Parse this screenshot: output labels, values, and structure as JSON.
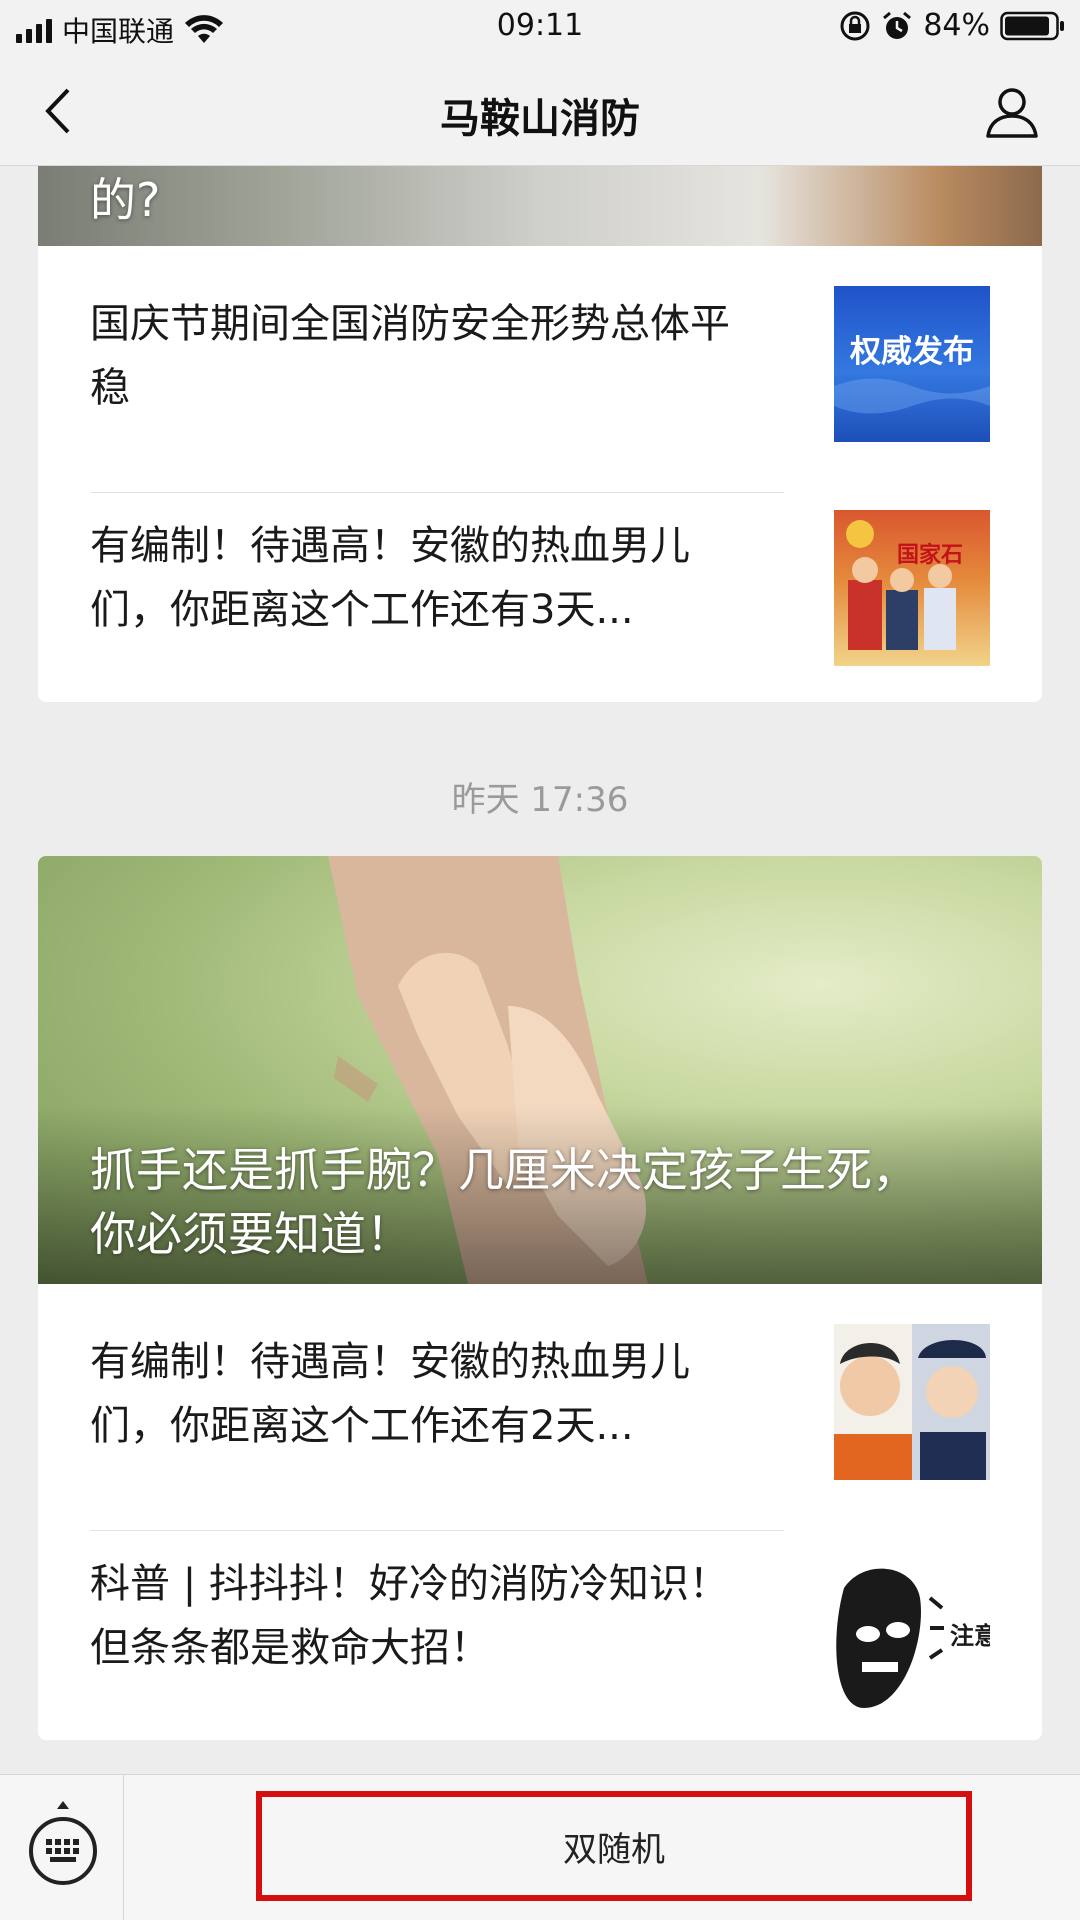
{
  "status_bar": {
    "carrier": "中国联通",
    "time": "09:11",
    "battery": "84%"
  },
  "nav": {
    "title": "马鞍山消防"
  },
  "group1": {
    "hero_title": "的?",
    "items": [
      {
        "title": "国庆节期间全国消防安全形势总体平稳",
        "thumb_text": "权威发布"
      },
      {
        "title": "有编制！待遇高！安徽的热血男儿们，你距离这个工作还有3天...",
        "thumb_text": "国家石"
      }
    ]
  },
  "timestamp": "昨天 17:36",
  "group2": {
    "hero_title": "抓手还是抓手腕？几厘米决定孩子生死，你必须要知道！",
    "items": [
      {
        "title": "有编制！待遇高！安徽的热血男儿们，你距离这个工作还有2天..."
      },
      {
        "title": "科普 | 抖抖抖！好冷的消防冷知识！但条条都是救命大招！",
        "thumb_text": "注意"
      }
    ]
  },
  "bottom_bar": {
    "menu_label": "双随机"
  },
  "colors": {
    "highlight_border": "#d30f0f",
    "background": "#ededed"
  },
  "icons": [
    "signal-icon",
    "wifi-icon",
    "rotation-lock-icon",
    "alarm-icon",
    "battery-icon",
    "back-icon",
    "profile-icon",
    "keyboard-icon"
  ]
}
